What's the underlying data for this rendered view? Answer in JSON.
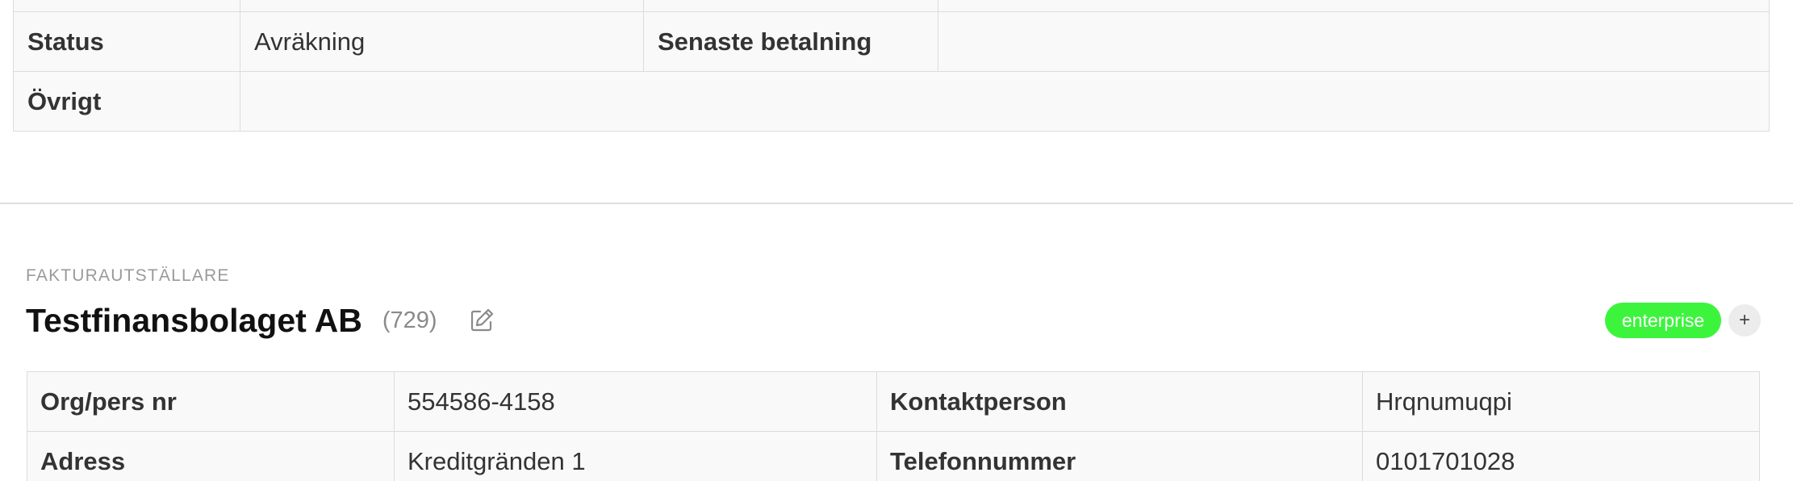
{
  "top_table": {
    "rows": [
      {
        "cells": [
          {
            "text": "Status",
            "label": true
          },
          {
            "text": "Avräkning",
            "label": false
          },
          {
            "text": "Senaste betalning",
            "label": true
          },
          {
            "text": "",
            "label": false
          }
        ]
      },
      {
        "cells": [
          {
            "text": "Övrigt",
            "label": true
          },
          {
            "text": "",
            "label": false
          }
        ]
      }
    ]
  },
  "issuer": {
    "section_label": "FAKTURAUTSTÄLLARE",
    "company_name": "Testfinansbolaget AB",
    "company_id": "(729)",
    "edit_icon": "edit-icon",
    "tag": "enterprise",
    "tag_color": "#3df43d",
    "add_tag_label": "+",
    "rows": [
      {
        "label1": "Org/pers nr",
        "value1": "554586-4158",
        "label2": "Kontaktperson",
        "value2": "Hrqnumuqpi"
      },
      {
        "label1": "Adress",
        "value1": "Kreditgränden 1",
        "label2": "Telefonnummer",
        "value2": "0101701028"
      }
    ]
  }
}
